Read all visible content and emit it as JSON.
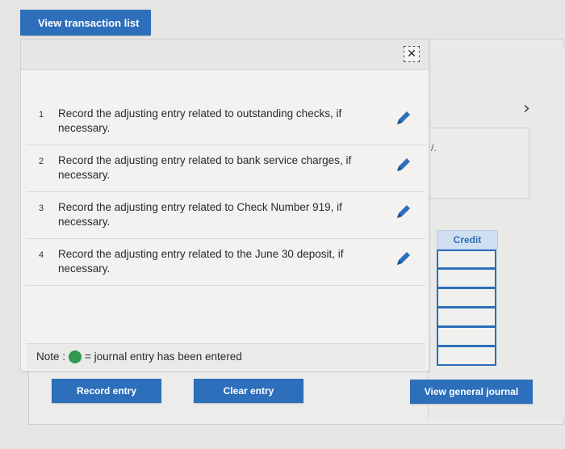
{
  "tab": {
    "label": "View transaction list"
  },
  "tasks": [
    {
      "num": "1",
      "text": "Record the adjusting entry related to outstanding checks, if necessary."
    },
    {
      "num": "2",
      "text": "Record the adjusting entry related to bank service charges, if necessary."
    },
    {
      "num": "3",
      "text": "Record the adjusting entry related to Check Number 919, if necessary."
    },
    {
      "num": "4",
      "text": "Record the adjusting entry related to the June 30 deposit, if necessary."
    }
  ],
  "note": {
    "prefix": "Note :",
    "suffix": "= journal entry has been entered"
  },
  "background": {
    "dot_text": "/.",
    "credit_header": "Credit"
  },
  "buttons": {
    "record": "Record entry",
    "clear": "Clear entry",
    "view_journal": "View general journal"
  },
  "icons": {
    "close": "close-icon",
    "chevron": "chevron-right-icon",
    "edit": "pencil-icon"
  },
  "colors": {
    "accent": "#2d6fba",
    "entered_dot": "#2e9a52"
  }
}
